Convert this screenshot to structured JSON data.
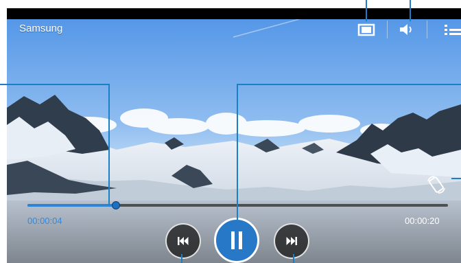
{
  "player": {
    "title": "Samsung",
    "current_time": "00:00:04",
    "total_time": "00:00:20",
    "progress": 0.21
  },
  "icons": {
    "screen_size": "fit-screen-icon",
    "volume": "volume-icon",
    "menu": "menu-icon",
    "rotate": "screen-rotation-icon",
    "previous": "skip-previous-icon",
    "pause": "pause-icon",
    "next": "skip-next-icon"
  },
  "colors": {
    "accent": "#2878c8",
    "callout": "#1a7fc4",
    "time_current": "#2f8ae0"
  }
}
